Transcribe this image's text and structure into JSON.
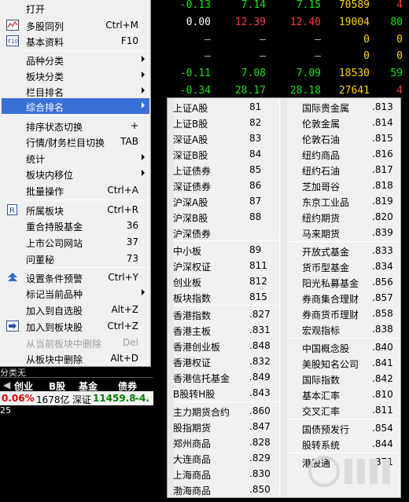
{
  "quotes": [
    {
      "c1": "-0.13",
      "c2": "7.14",
      "c3": "7.15",
      "c4": "70589",
      "c5": "4",
      "cls": [
        "green",
        "green",
        "green",
        "yellow",
        "red"
      ]
    },
    {
      "c1": "0.00",
      "c2": "12.39",
      "c3": "12.40",
      "c4": "19004",
      "c5": "80",
      "cls": [
        "white",
        "red",
        "red",
        "yellow",
        "green"
      ]
    },
    {
      "c1": "–",
      "c2": "–",
      "c3": "–",
      "c4": "0",
      "c5": "0",
      "cls": [
        "gray",
        "gray",
        "gray",
        "yellow",
        "yellow"
      ]
    },
    {
      "c1": "–",
      "c2": "–",
      "c3": "–",
      "c4": "0",
      "c5": "0",
      "cls": [
        "gray",
        "gray",
        "gray",
        "yellow",
        "yellow"
      ]
    },
    {
      "c1": "-0.11",
      "c2": "7.08",
      "c3": "7.09",
      "c4": "18530",
      "c5": "59",
      "cls": [
        "green",
        "green",
        "green",
        "yellow",
        "green"
      ]
    },
    {
      "c1": "-0.34",
      "c2": "28.17",
      "c3": "28.18",
      "c4": "27641",
      "c5": "4",
      "cls": [
        "green",
        "green",
        "green",
        "yellow",
        "red"
      ]
    }
  ],
  "market_tabs": [
    "创业",
    "B股",
    "基金",
    "债券"
  ],
  "background_text": {
    "row_partial": "分类无",
    "row3": "25"
  },
  "statusbar": {
    "pct": "0.06%",
    "amount": "1678亿",
    "index_name": "深证",
    "index_value": "11459.8",
    "index_change": "-4."
  },
  "main_menu": {
    "items": [
      {
        "label": "打开",
        "shortcut": ""
      },
      {
        "label": "多股同列",
        "shortcut": "Ctrl+M",
        "icon": "multi-chart-icon"
      },
      {
        "label": "基本资料",
        "shortcut": "F10",
        "icon": "f10-icon"
      },
      {
        "label": "品种分类",
        "shortcut": "",
        "submenu": true
      },
      {
        "label": "板块分类",
        "shortcut": "",
        "submenu": true
      },
      {
        "label": "栏目排名",
        "shortcut": "",
        "submenu": true
      },
      {
        "label": "综合排名",
        "shortcut": "",
        "submenu": true,
        "highlighted": true
      },
      {
        "label": "排序状态切换",
        "shortcut": "+"
      },
      {
        "label": "行情/财务栏目切换",
        "shortcut": "TAB"
      },
      {
        "label": "统计",
        "shortcut": "",
        "submenu": true
      },
      {
        "label": "板块内移位",
        "shortcut": "",
        "submenu": true
      },
      {
        "label": "批量操作",
        "shortcut": "Ctrl+A"
      },
      {
        "label": "所属板块",
        "shortcut": "Ctrl+R",
        "icon": "r-icon"
      },
      {
        "label": "重合持股基金",
        "shortcut": "36"
      },
      {
        "label": "上市公司网站",
        "shortcut": "37"
      },
      {
        "label": "问董秘",
        "shortcut": "73"
      },
      {
        "label": "设置条件预警",
        "shortcut": "Ctrl+Y",
        "icon": "alert-icon"
      },
      {
        "label": "标记当前品种",
        "shortcut": "",
        "submenu": true
      },
      {
        "label": "加入到自选股",
        "shortcut": "Alt+Z"
      },
      {
        "label": "加入到板块股",
        "shortcut": "Ctrl+Z",
        "icon": "add-block-icon"
      },
      {
        "label": "从当前板块中删除",
        "shortcut": "Del",
        "disabled": true
      },
      {
        "label": "从板块中删除",
        "shortcut": "Alt+D"
      }
    ]
  },
  "submenu": {
    "left": [
      {
        "label": "上证A股",
        "code": "81"
      },
      {
        "label": "上证B股",
        "code": "82"
      },
      {
        "label": "深证A股",
        "code": "83"
      },
      {
        "label": "深证B股",
        "code": "84"
      },
      {
        "label": "上证债券",
        "code": "85"
      },
      {
        "label": "深证债券",
        "code": "86"
      },
      {
        "label": "沪深A股",
        "code": "87"
      },
      {
        "label": "沪深B股",
        "code": "88"
      },
      {
        "label": "沪深债券",
        "code": ""
      },
      {
        "label": "中小板",
        "code": "89"
      },
      {
        "label": "沪深权证",
        "code": "811"
      },
      {
        "label": "创业板",
        "code": "812"
      },
      {
        "label": "板块指数",
        "code": "815"
      },
      {
        "label": "香港指数",
        "code": ".827"
      },
      {
        "label": "香港主板",
        "code": ".831"
      },
      {
        "label": "香港创业板",
        "code": ".848"
      },
      {
        "label": "香港权证",
        "code": ".832"
      },
      {
        "label": "香港信托基金",
        "code": ".849"
      },
      {
        "label": "B股转H股",
        "code": ".843"
      },
      {
        "label": "主力期货合约",
        "code": ".860"
      },
      {
        "label": "股指期货",
        "code": ".847"
      },
      {
        "label": "郑州商品",
        "code": ".828"
      },
      {
        "label": "大连商品",
        "code": ".829"
      },
      {
        "label": "上海商品",
        "code": ".830"
      },
      {
        "label": "渤海商品",
        "code": ".850"
      }
    ],
    "right": [
      {
        "label": "国际贵金属",
        "code": ".813"
      },
      {
        "label": "伦敦金属",
        "code": ".814"
      },
      {
        "label": "伦敦石油",
        "code": ".815"
      },
      {
        "label": "纽约商品",
        "code": ".816"
      },
      {
        "label": "纽约石油",
        "code": ".817"
      },
      {
        "label": "芝加哥谷",
        "code": ".818"
      },
      {
        "label": "东京工业品",
        "code": ".819"
      },
      {
        "label": "纽约期货",
        "code": ".820"
      },
      {
        "label": "马来期货",
        "code": ".839"
      },
      {
        "label": "开放式基金",
        "code": ".833"
      },
      {
        "label": "货币型基金",
        "code": ".834"
      },
      {
        "label": "阳光私募基金",
        "code": ".856"
      },
      {
        "label": "券商集合理财",
        "code": ".857"
      },
      {
        "label": "券商货币理财",
        "code": ".858"
      },
      {
        "label": "宏观指标",
        "code": ".838"
      },
      {
        "label": "中国概念股",
        "code": ".840"
      },
      {
        "label": "美股知名公司",
        "code": ".841"
      },
      {
        "label": "国际指数",
        "code": ".842"
      },
      {
        "label": "基本汇率",
        "code": ".810"
      },
      {
        "label": "交叉汇率",
        "code": ".811"
      },
      {
        "label": "国债预发行",
        "code": ".854"
      },
      {
        "label": "股转系统",
        "code": ".844"
      },
      {
        "label": "港股通",
        "code": ".871"
      }
    ]
  },
  "colors": {
    "highlight": "#3a6fd8",
    "menu_bg": "#f0f0f0",
    "quote_green": "#14e314",
    "quote_red": "#ff3b3b",
    "quote_yellow": "#ffd400"
  }
}
